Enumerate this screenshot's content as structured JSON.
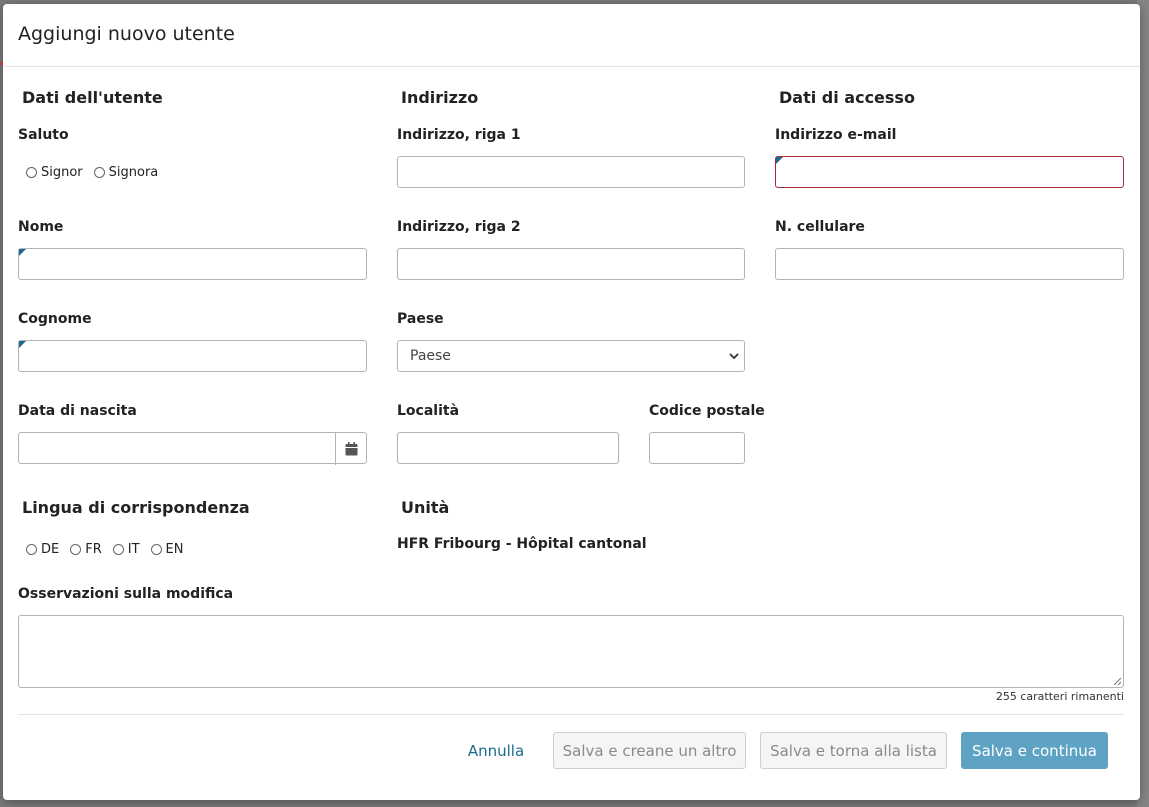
{
  "modal": {
    "title": "Aggiungi nuovo utente"
  },
  "user_data": {
    "section_title": "Dati dell'utente",
    "salutation_label": "Saluto",
    "salutation_options": [
      "Signor",
      "Signora"
    ],
    "first_name_label": "Nome",
    "last_name_label": "Cognome",
    "birth_date_label": "Data di nascita",
    "correspondence_lang_title": "Lingua di corrispondenza",
    "languages": [
      "DE",
      "FR",
      "IT",
      "EN"
    ]
  },
  "address": {
    "section_title": "Indirizzo",
    "line1_label": "Indirizzo, riga 1",
    "line2_label": "Indirizzo, riga 2",
    "country_label": "Paese",
    "country_selected": "Paese",
    "city_label": "Località",
    "postal_code_label": "Codice postale",
    "unit_title": "Unità",
    "unit_value": "HFR Fribourg - Hôpital cantonal"
  },
  "access": {
    "section_title": "Dati di accesso",
    "email_label": "Indirizzo e-mail",
    "mobile_label": "N. cellulare"
  },
  "remarks": {
    "label": "Osservazioni sulla modifica",
    "chars_left": "255 caratteri rimanenti"
  },
  "footer": {
    "cancel": "Annulla",
    "save_new": "Salva e creane un altro",
    "save_back": "Salva e torna alla lista",
    "save_continue": "Salva e continua"
  },
  "colors": {
    "primary": "#5fa3c4",
    "link": "#1b6b8e",
    "error_border": "#a52a3c"
  }
}
